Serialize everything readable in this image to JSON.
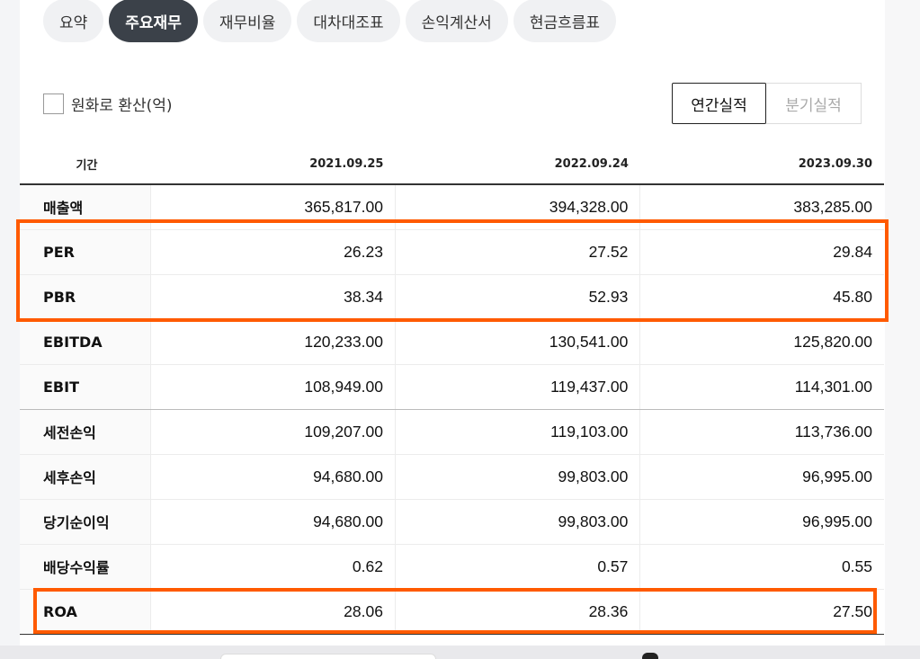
{
  "tabs": [
    {
      "label": "요약",
      "active": false
    },
    {
      "label": "주요재무",
      "active": true
    },
    {
      "label": "재무비율",
      "active": false
    },
    {
      "label": "대차대조표",
      "active": false
    },
    {
      "label": "손익계산서",
      "active": false
    },
    {
      "label": "현금흐름표",
      "active": false
    }
  ],
  "convert_checkbox": {
    "label": "원화로 환산(억)",
    "checked": false
  },
  "period_toggle": {
    "annual": "연간실적",
    "quarter": "분기실적",
    "selected": "연간실적"
  },
  "table": {
    "header": {
      "label": "기간",
      "periods": [
        "2021.09.25",
        "2022.09.24",
        "2023.09.30"
      ]
    },
    "rows": [
      {
        "name": "매출액",
        "values": [
          "365,817.00",
          "394,328.00",
          "383,285.00"
        ]
      },
      {
        "name": "PER",
        "values": [
          "26.23",
          "27.52",
          "29.84"
        ]
      },
      {
        "name": "PBR",
        "values": [
          "38.34",
          "52.93",
          "45.80"
        ]
      },
      {
        "name": "EBITDA",
        "values": [
          "120,233.00",
          "130,541.00",
          "125,820.00"
        ]
      },
      {
        "name": "EBIT",
        "values": [
          "108,949.00",
          "119,437.00",
          "114,301.00"
        ]
      },
      {
        "name": "세전손익",
        "values": [
          "109,207.00",
          "119,103.00",
          "113,736.00"
        ]
      },
      {
        "name": "세후손익",
        "values": [
          "94,680.00",
          "99,803.00",
          "96,995.00"
        ]
      },
      {
        "name": "당기순이익",
        "values": [
          "94,680.00",
          "99,803.00",
          "96,995.00"
        ]
      },
      {
        "name": "배당수익률",
        "values": [
          "0.62",
          "0.57",
          "0.55"
        ]
      },
      {
        "name": "ROA",
        "values": [
          "28.06",
          "28.36",
          "27.50"
        ]
      }
    ]
  },
  "highlight_color": "#ff5a00"
}
